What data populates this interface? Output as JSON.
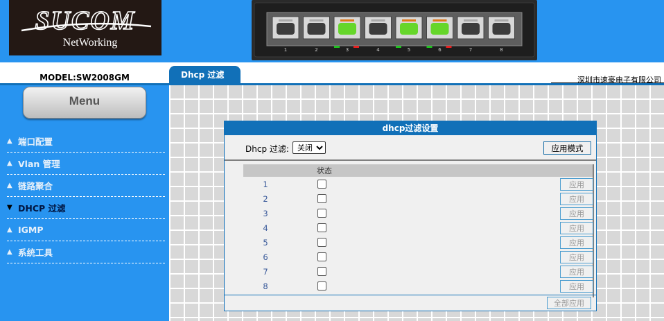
{
  "brand": {
    "logo_name": "SUCOM",
    "logo_sub": "NetWorking",
    "model": "MODEL:SW2008GM",
    "company": "深圳市速豪电子有限公司"
  },
  "switch_panel": {
    "ports": [
      {
        "label": "1",
        "active": false
      },
      {
        "label": "2",
        "active": false
      },
      {
        "label": "3",
        "active": true
      },
      {
        "label": "4",
        "active": false
      },
      {
        "label": "5",
        "active": true
      },
      {
        "label": "6",
        "active": true
      },
      {
        "label": "7",
        "active": false
      },
      {
        "label": "8",
        "active": false
      }
    ],
    "active_color": "#66d62a",
    "green_led": "#20c020",
    "red_led": "#e82020"
  },
  "tab": {
    "label": "Dhcp 过滤"
  },
  "sidebar": {
    "menu_label": "Menu",
    "items": [
      {
        "label": "端口配置",
        "active": false
      },
      {
        "label": "Vlan 管理",
        "active": false
      },
      {
        "label": "链路聚合",
        "active": false
      },
      {
        "label": "DHCP 过滤",
        "active": true
      },
      {
        "label": "IGMP",
        "active": false
      },
      {
        "label": "系统工具",
        "active": false
      }
    ]
  },
  "dialog": {
    "title": "dhcp过滤设置",
    "filter_label": "Dhcp 过滤:",
    "filter_value": "关闭",
    "apply_mode_label": "应用模式",
    "status_header": "状态",
    "apply_label": "应用",
    "apply_all_label": "全部应用",
    "rows": [
      "1",
      "2",
      "3",
      "4",
      "5",
      "6",
      "7",
      "8"
    ]
  },
  "colors": {
    "primary_blue": "#2894f0",
    "dark_blue": "#1170b8"
  }
}
